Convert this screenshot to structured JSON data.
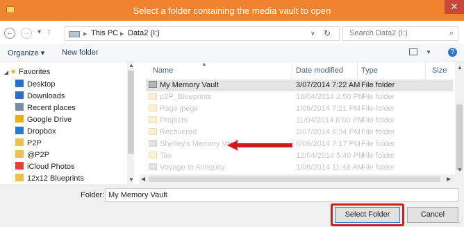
{
  "window": {
    "title": "Select a folder containing the media vault to open",
    "close_glyph": "✕"
  },
  "nav": {
    "back_glyph": "←",
    "forward_glyph": "→",
    "recent_glyph": "▾",
    "up_glyph": "↑",
    "breadcrumb": [
      "This PC",
      "Data2 (I:)"
    ],
    "breadcrumb_sep": "▸",
    "dropdown_glyph": "∨",
    "refresh_glyph": "↻",
    "search_placeholder": "Search Data2 (I:)",
    "search_glyph": "⌕"
  },
  "toolbar": {
    "organize_label": "Organize ▾",
    "new_folder_label": "New folder",
    "help_glyph": "?"
  },
  "sidebar": {
    "favorites_label": "Favorites",
    "items": [
      {
        "label": "Desktop",
        "icon": "desktop-icon",
        "color": "#2b6fc5"
      },
      {
        "label": "Downloads",
        "icon": "downloads-icon",
        "color": "#2b6fc5"
      },
      {
        "label": "Recent places",
        "icon": "recent-places-icon",
        "color": "#7a8da0"
      },
      {
        "label": "Google Drive",
        "icon": "google-drive-icon",
        "color": "#e8b40c"
      },
      {
        "label": "Dropbox",
        "icon": "dropbox-icon",
        "color": "#1f7ad8"
      },
      {
        "label": "P2P",
        "icon": "folder-icon",
        "color": "#e9c24f"
      },
      {
        "label": "@P2P",
        "icon": "folder-icon",
        "color": "#e9c24f"
      },
      {
        "label": "iCloud Photos",
        "icon": "icloud-photos-icon",
        "color": "#d9473b"
      },
      {
        "label": "12x12 Blueprints",
        "icon": "folder-icon",
        "color": "#e9c24f"
      }
    ]
  },
  "columns": {
    "name": "Name",
    "date": "Date modified",
    "type": "Type",
    "size": "Size"
  },
  "files": [
    {
      "name": "My Memory Vault",
      "date": "3/07/2014 7:22 AM",
      "type": "File folder",
      "icon": "vault-folder-icon",
      "state": "selected"
    },
    {
      "name": "p2P_Blueprints",
      "date": "16/04/2014 2:50 PM",
      "type": "File folder",
      "icon": "folder-icon",
      "state": "dim"
    },
    {
      "name": "Page jpegs",
      "date": "1/09/2014 7:21 PM",
      "type": "File folder",
      "icon": "folder-icon",
      "state": "dim"
    },
    {
      "name": "Projects",
      "date": "11/04/2014 8:00 PM",
      "type": "File folder",
      "icon": "folder-icon",
      "state": "dim"
    },
    {
      "name": "Recovered",
      "date": "2/07/2014 6:34 PM",
      "type": "File folder",
      "icon": "folder-icon",
      "state": "dim"
    },
    {
      "name": "Shelley's Memory Vault",
      "date": "6/09/2014 7:17 PM",
      "type": "File folder",
      "icon": "vault-folder-icon",
      "state": "dim"
    },
    {
      "name": "Tax",
      "date": "12/04/2014 5:40 PM",
      "type": "File folder",
      "icon": "folder-icon",
      "state": "dim"
    },
    {
      "name": "Voyage to Antiquity",
      "date": "1/08/2014 11:48 AM",
      "type": "File folder",
      "icon": "vault-folder-icon",
      "state": "dim"
    }
  ],
  "bottom": {
    "folder_label": "Folder:",
    "folder_value": "My Memory Vault",
    "select_label": "Select Folder",
    "cancel_label": "Cancel"
  },
  "colors": {
    "titlebar": "#f0832f",
    "highlight": "#d11b22",
    "close": "#c8463a"
  }
}
